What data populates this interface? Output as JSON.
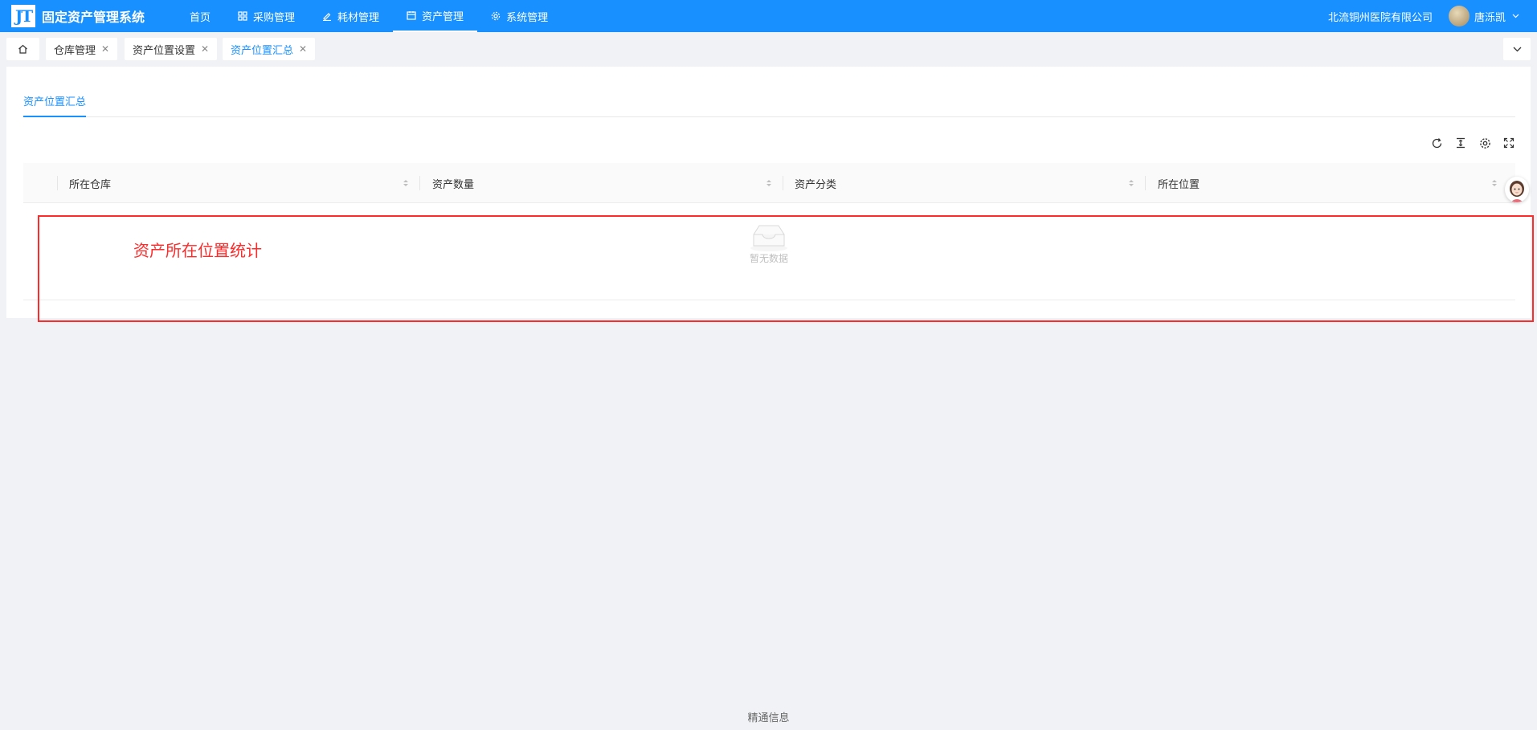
{
  "app": {
    "logo_mark": "JT",
    "title": "固定资产管理系统"
  },
  "nav": {
    "items": [
      {
        "label": "首页",
        "icon": "none"
      },
      {
        "label": "采购管理",
        "icon": "grid-icon"
      },
      {
        "label": "耗材管理",
        "icon": "pen-icon"
      },
      {
        "label": "资产管理",
        "icon": "calendar-icon"
      },
      {
        "label": "系统管理",
        "icon": "gear-icon"
      }
    ],
    "active_index": 3
  },
  "header": {
    "company": "北流铜州医院有限公司",
    "user_name": "唐泺凯"
  },
  "tabs": [
    {
      "label": "仓库管理"
    },
    {
      "label": "资产位置设置"
    },
    {
      "label": "资产位置汇总"
    }
  ],
  "page": {
    "subtab": "资产位置汇总",
    "columns": [
      "所在仓库",
      "资产数量",
      "资产分类",
      "所在位置"
    ],
    "empty_text": "暂无数据"
  },
  "annotation": {
    "text": "资产所在位置统计",
    "color": "#ff2a2a"
  },
  "footer": {
    "text": "精通信息"
  },
  "colors": {
    "primary": "#1890ff",
    "background": "#f0f2f5"
  }
}
